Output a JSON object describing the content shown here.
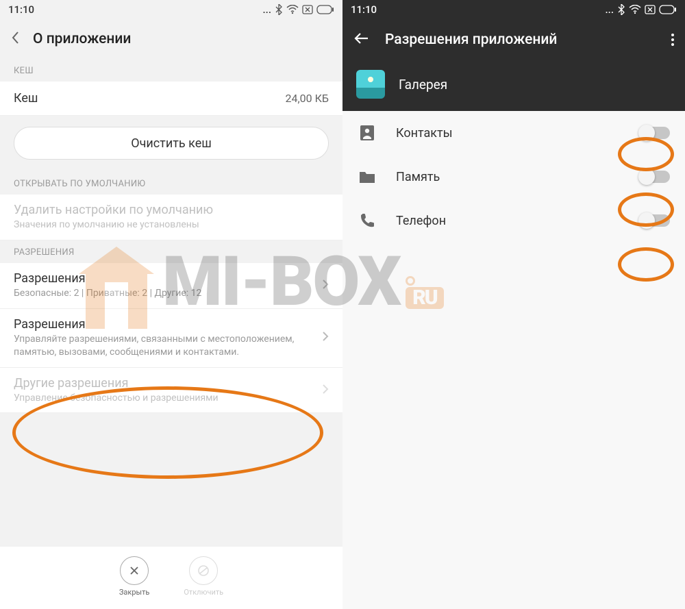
{
  "status": {
    "time": "11:10",
    "dots": "..."
  },
  "left": {
    "title": "О приложении",
    "sections": {
      "cache_header": "КЕШ",
      "cache_label": "Кеш",
      "cache_value": "24,00 КБ",
      "clear_cache": "Очистить кеш",
      "open_default_header": "ОТКРЫВАТЬ ПО УМОЛЧАНИЮ",
      "delete_defaults_title": "Удалить настройки по умолчанию",
      "delete_defaults_sub": "Значения по умолчанию не установлены",
      "permissions_header": "РАЗРЕШЕНИЯ",
      "perms1_title": "Разрешения",
      "perms1_sub": "Безопасные: 2 | Приватные: 2 | Другие: 12",
      "perms2_title": "Разрешения",
      "perms2_sub": "Управляйте разрешениями, связанными с местоположением, памятью, вызовами, сообщениями и контактами.",
      "other_perms_title": "Другие разрешения",
      "other_perms_sub": "Управление безопасностью и разрешениями"
    },
    "bottom": {
      "close": "Закрыть",
      "disable": "Отключить"
    }
  },
  "right": {
    "title": "Разрешения приложений",
    "app_name": "Галерея",
    "permissions": [
      {
        "label": "Контакты"
      },
      {
        "label": "Память"
      },
      {
        "label": "Телефон"
      }
    ]
  },
  "watermark": {
    "prefix": "MI-",
    "main": "BOX",
    "suffix": "RU"
  }
}
